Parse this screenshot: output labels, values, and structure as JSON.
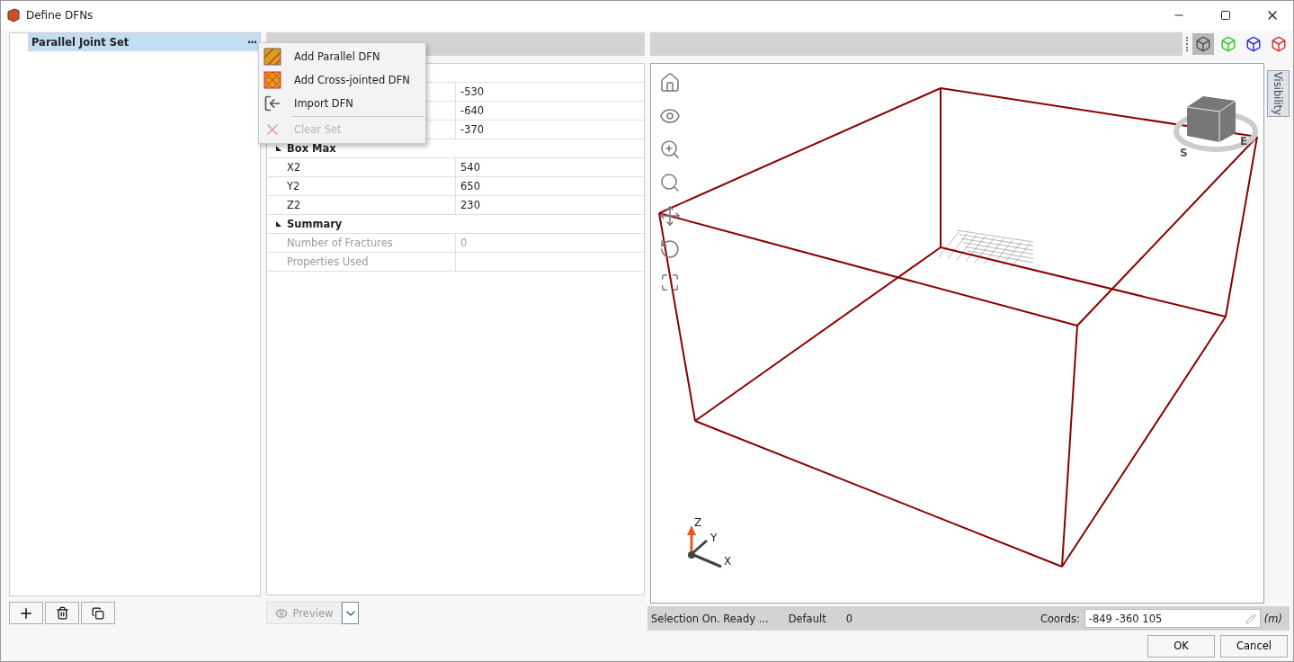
{
  "window": {
    "title": "Define DFNs"
  },
  "tree": {
    "items": [
      {
        "label": "Parallel Joint Set",
        "selected": true,
        "more": "···"
      }
    ]
  },
  "context_menu": {
    "items": [
      {
        "label": "Add Parallel DFN",
        "kind": "parallel",
        "disabled": false,
        "separator": false
      },
      {
        "label": "Add Cross-jointed DFN",
        "kind": "cross",
        "disabled": false,
        "separator": false
      },
      {
        "label": "Import DFN",
        "kind": "import",
        "disabled": false,
        "separator": false
      },
      {
        "label": "Clear Set",
        "kind": "clear",
        "disabled": true,
        "separator": true
      }
    ]
  },
  "properties": {
    "groups": [
      {
        "rows": [
          {
            "value": "-530",
            "disabled": false
          },
          {
            "value": "-640",
            "disabled": false
          },
          {
            "value": "-370",
            "disabled": false
          }
        ]
      },
      {
        "title": "Box Max",
        "expanded": true,
        "rows": [
          {
            "name": "X2",
            "value": "540",
            "disabled": false
          },
          {
            "name": "Y2",
            "value": "650",
            "disabled": false
          },
          {
            "name": "Z2",
            "value": "230",
            "disabled": false
          }
        ]
      },
      {
        "title": "Summary",
        "expanded": true,
        "rows": [
          {
            "name": "Number of Fractures",
            "value": "0",
            "disabled": true
          },
          {
            "name": "Properties Used",
            "disabled": true
          }
        ]
      }
    ]
  },
  "preview_button": {
    "label": "Preview",
    "disabled": true
  },
  "view_buttons": [
    {
      "kind": "perspective",
      "selected": true
    },
    {
      "kind": "top",
      "selected": false
    },
    {
      "kind": "front",
      "selected": false
    },
    {
      "kind": "side",
      "selected": false
    }
  ],
  "viewport": {
    "side_tab": "Visibility",
    "compass": [
      "S",
      "E"
    ],
    "axes": [
      "Z",
      "Y",
      "X"
    ]
  },
  "status_bar": {
    "items": [
      "Selection On. Ready ...",
      "Default",
      "0"
    ],
    "coords_label": "Coords:",
    "coords_value": "-849 -360 105",
    "units": "(m)"
  },
  "buttons": [
    "OK",
    "Cancel"
  ]
}
